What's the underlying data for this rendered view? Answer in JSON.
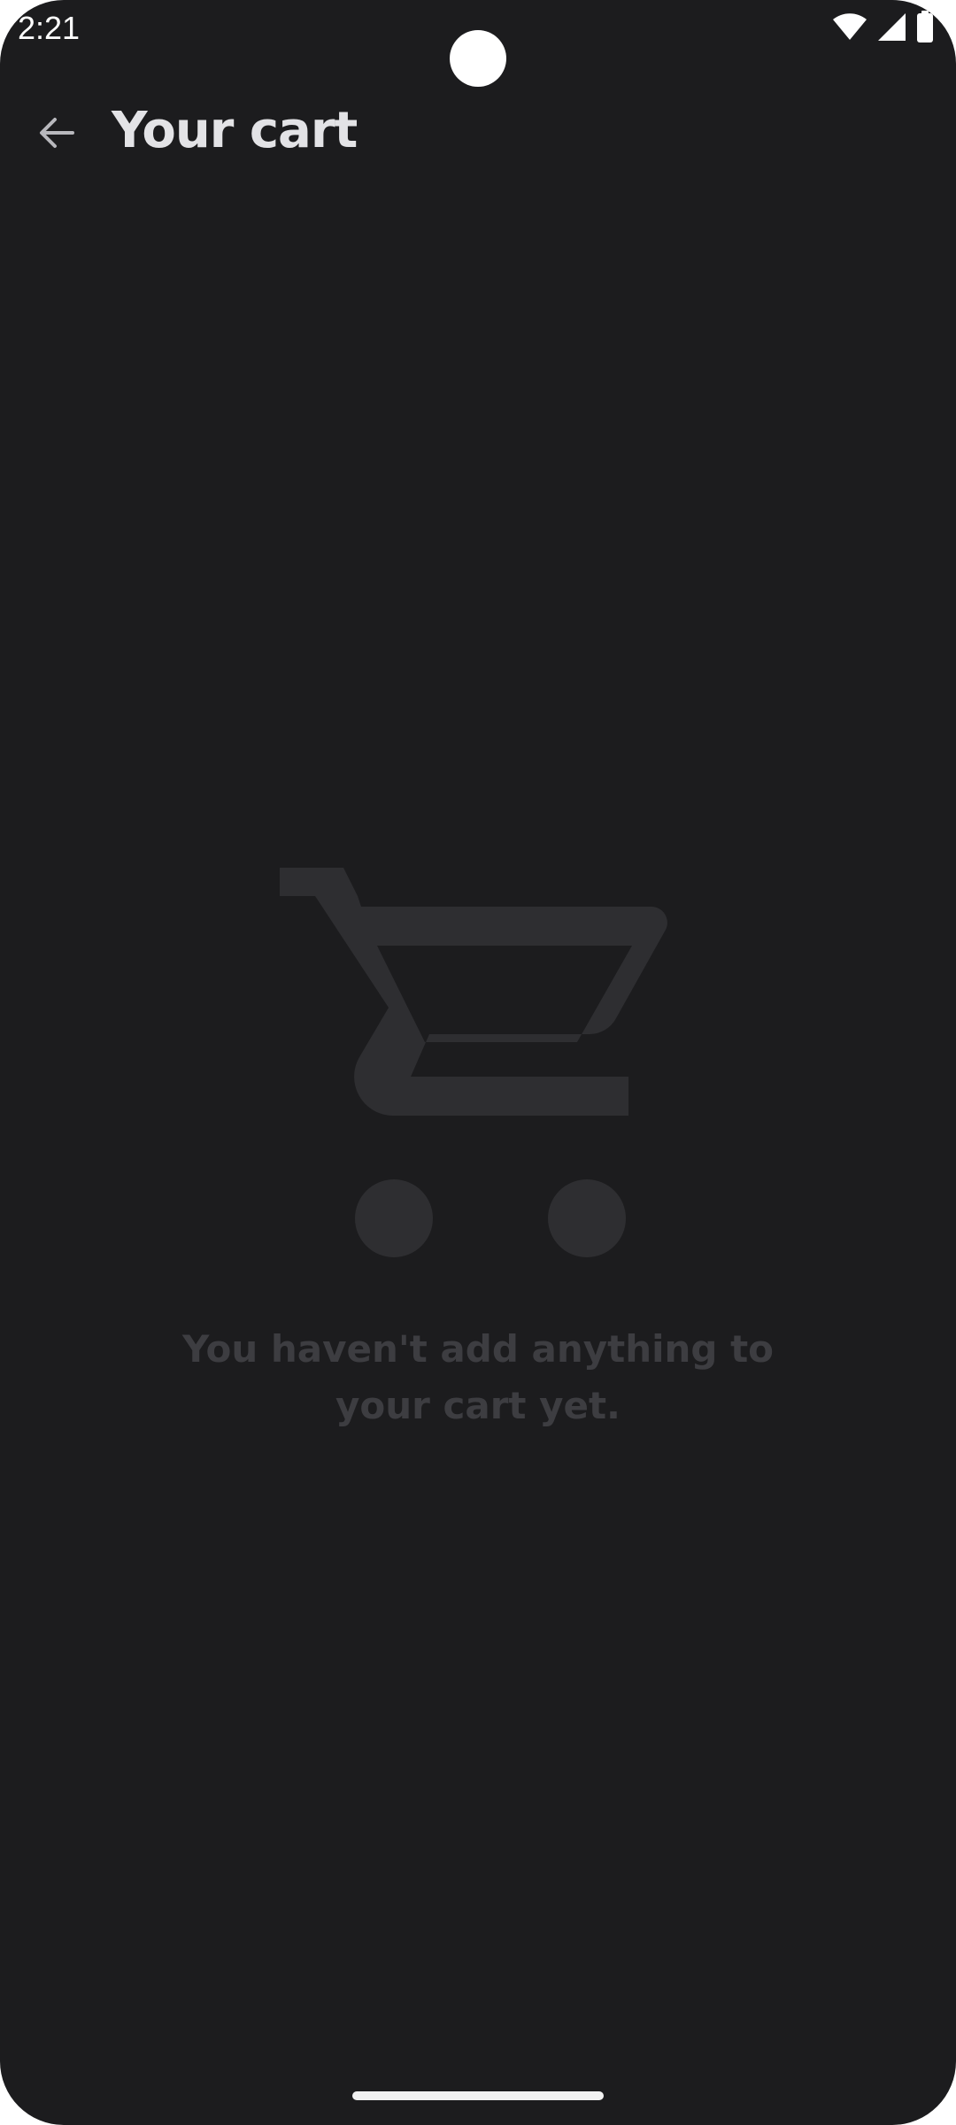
{
  "status_bar": {
    "time": "2:21",
    "icons": [
      "wifi-icon",
      "cellular-signal-icon",
      "battery-icon"
    ]
  },
  "app_bar": {
    "back_icon": "arrow-back-icon",
    "title": "Your cart"
  },
  "empty_state": {
    "icon": "shopping-cart-icon",
    "message": "You haven't add anything to your cart yet."
  },
  "colors": {
    "background": "#1c1c1e",
    "title_text": "#e3e3e6",
    "muted_illustration": "#2e2e31",
    "muted_text": "#3d3d41",
    "status_foreground": "#ffffff"
  }
}
